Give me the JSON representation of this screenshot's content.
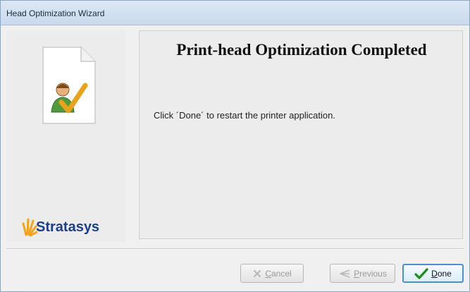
{
  "window": {
    "title": "Head Optimization Wizard"
  },
  "side": {
    "brand_name": "Stratasys",
    "brand_color": "#1c3f8c",
    "icon": "document-user-check-icon"
  },
  "main": {
    "heading": "Print-head Optimization Completed",
    "message": "Click ´Done´ to restart the printer application."
  },
  "buttons": {
    "cancel": {
      "mnemonic": "C",
      "rest": "ancel",
      "enabled": false
    },
    "previous": {
      "mnemonic": "P",
      "rest": "revious",
      "enabled": false
    },
    "done": {
      "mnemonic": "D",
      "rest": "one",
      "enabled": true
    }
  }
}
